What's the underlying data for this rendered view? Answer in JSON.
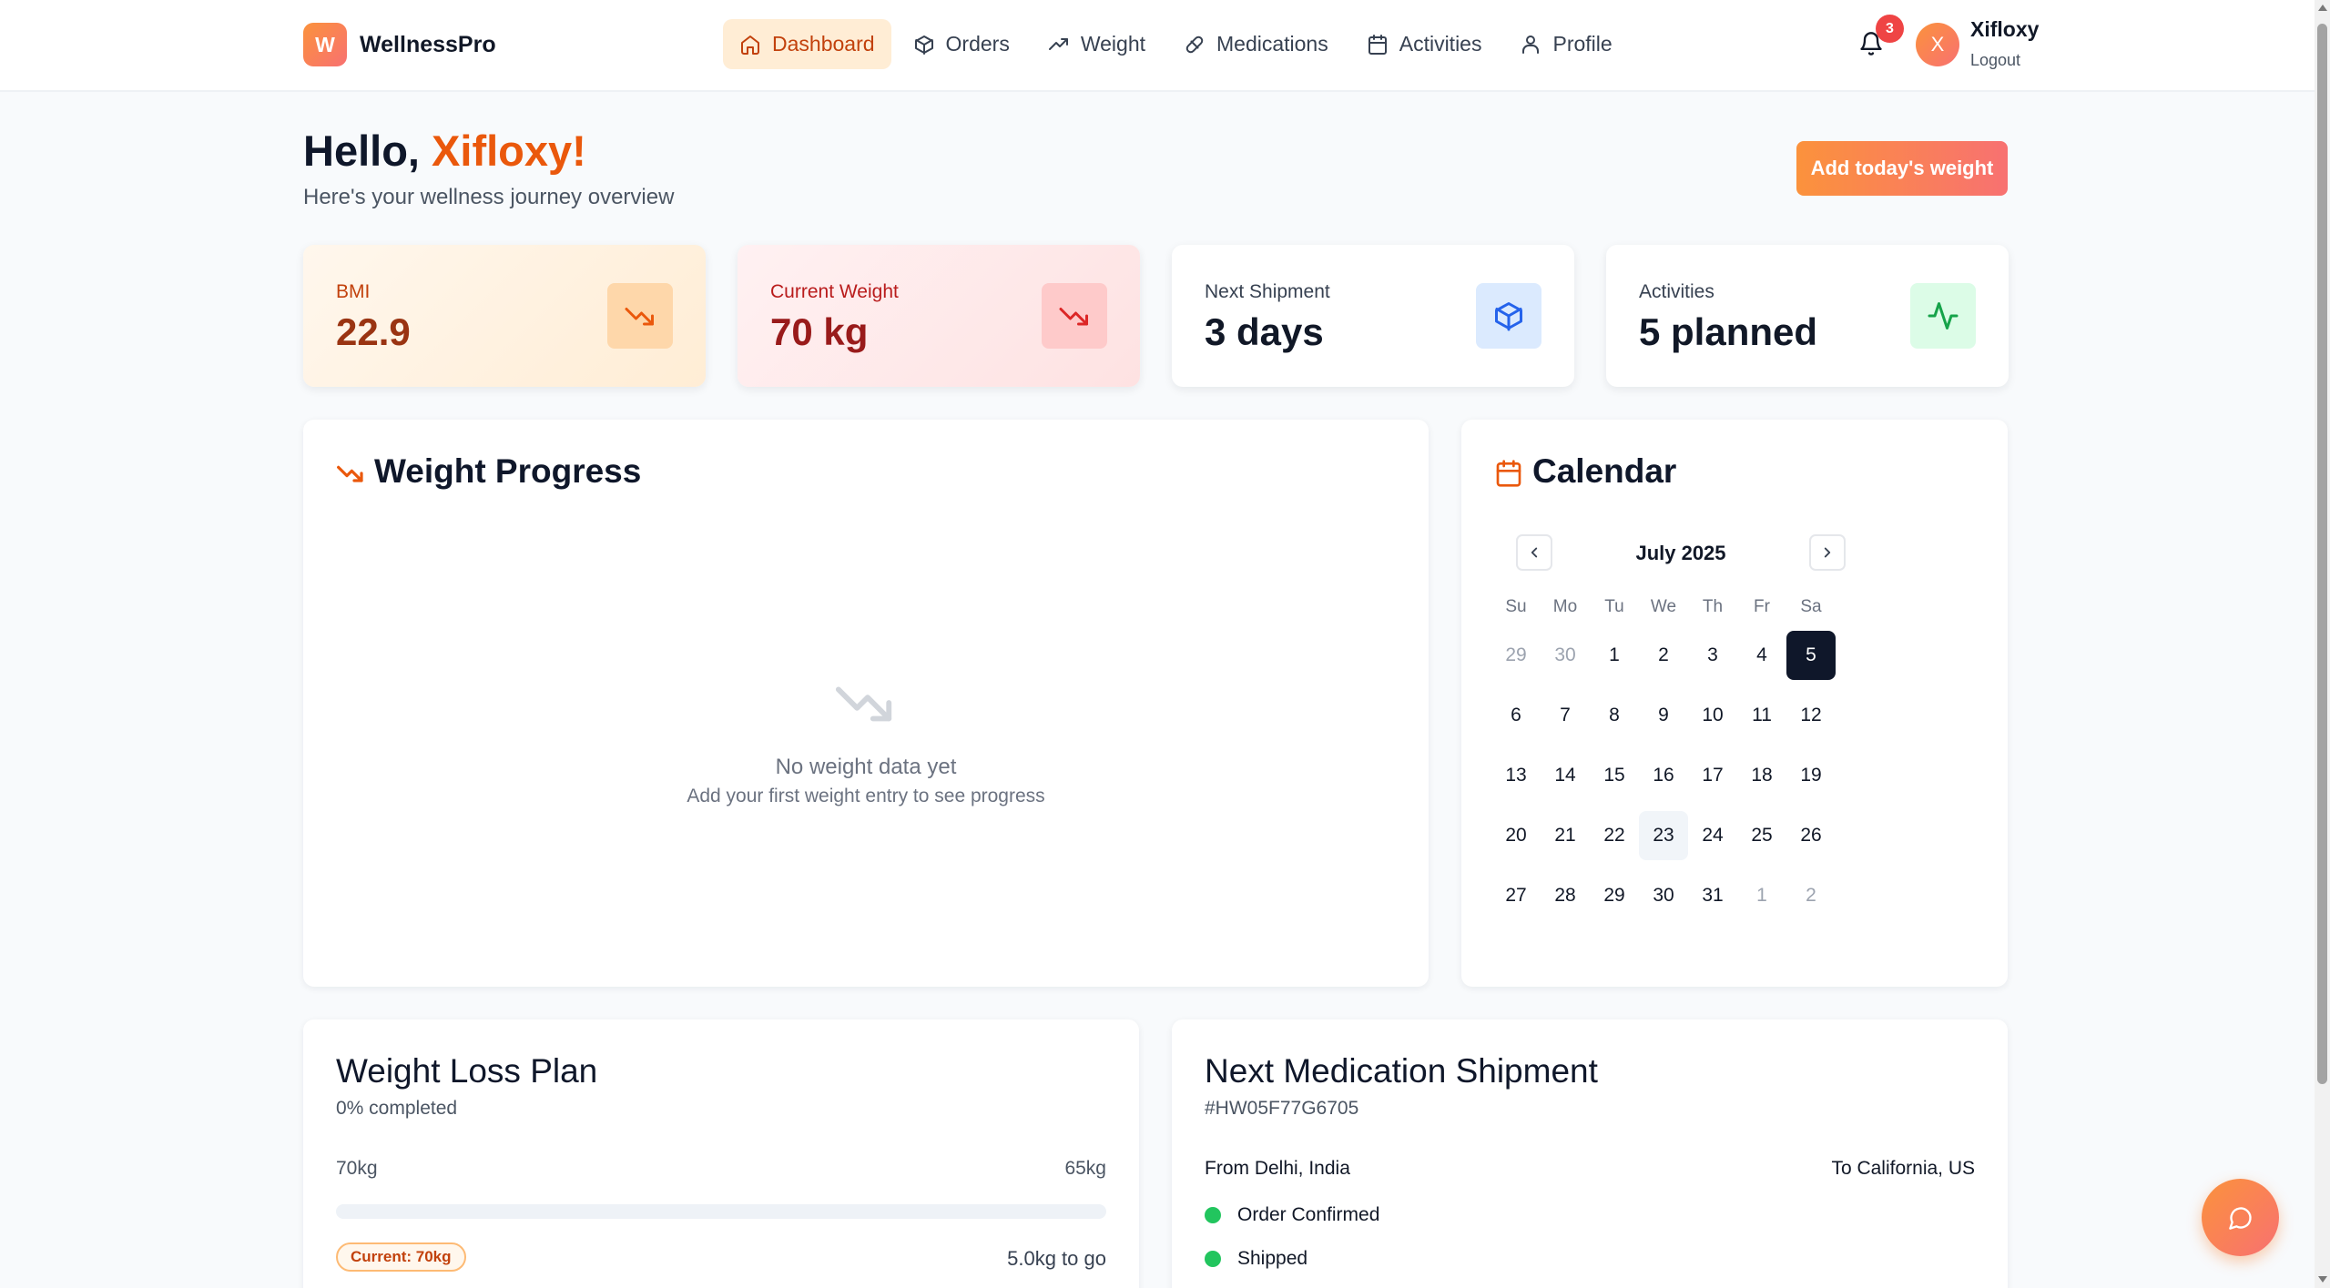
{
  "app": {
    "logo_letter": "W",
    "name": "WellnessPro"
  },
  "nav": {
    "items": [
      {
        "label": "Dashboard",
        "icon": "home-icon",
        "active": true
      },
      {
        "label": "Orders",
        "icon": "package-icon"
      },
      {
        "label": "Weight",
        "icon": "trending-up-icon"
      },
      {
        "label": "Medications",
        "icon": "pill-icon"
      },
      {
        "label": "Activities",
        "icon": "calendar-icon"
      },
      {
        "label": "Profile",
        "icon": "user-icon"
      }
    ],
    "notifications": "3",
    "user": {
      "initial": "X",
      "name": "Xifloxy",
      "logout": "Logout"
    }
  },
  "header": {
    "greeting_prefix": "Hello, ",
    "greeting_name": "Xifloxy!",
    "subtitle": "Here's your wellness journey overview",
    "add_button": "Add today's weight"
  },
  "stats": {
    "bmi": {
      "label": "BMI",
      "value": "22.9"
    },
    "weight": {
      "label": "Current Weight",
      "value": "70 kg"
    },
    "shipment": {
      "label": "Next Shipment",
      "value": "3 days"
    },
    "activities": {
      "label": "Activities",
      "value": "5 planned"
    }
  },
  "weight_progress": {
    "title": "Weight Progress",
    "empty_title": "No weight data yet",
    "empty_sub": "Add your first weight entry to see progress"
  },
  "calendar": {
    "title": "Calendar",
    "month": "July 2025",
    "weekdays": [
      "Su",
      "Mo",
      "Tu",
      "We",
      "Th",
      "Fr",
      "Sa"
    ],
    "weeks": [
      [
        "29",
        "30",
        "1",
        "2",
        "3",
        "4",
        "5"
      ],
      [
        "6",
        "7",
        "8",
        "9",
        "10",
        "11",
        "12"
      ],
      [
        "13",
        "14",
        "15",
        "16",
        "17",
        "18",
        "19"
      ],
      [
        "20",
        "21",
        "22",
        "23",
        "24",
        "25",
        "26"
      ],
      [
        "27",
        "28",
        "29",
        "30",
        "31",
        "1",
        "2"
      ]
    ],
    "selected": "5",
    "today": "23"
  },
  "plan": {
    "title": "Weight Loss Plan",
    "completed": "0% completed",
    "progress": 0,
    "start": "70kg",
    "goal": "65kg",
    "current": "Current: 70kg",
    "to_go": "5.0kg to go"
  },
  "shipment": {
    "title": "Next Medication Shipment",
    "id": "#HW05F77G6705",
    "from": "From Delhi, India",
    "to": "To California, US",
    "steps": [
      "Order Confirmed",
      "Shipped"
    ]
  },
  "colors": {
    "accent": "#ea580c",
    "success": "#22c55e",
    "selected_day": "#0f172a"
  }
}
